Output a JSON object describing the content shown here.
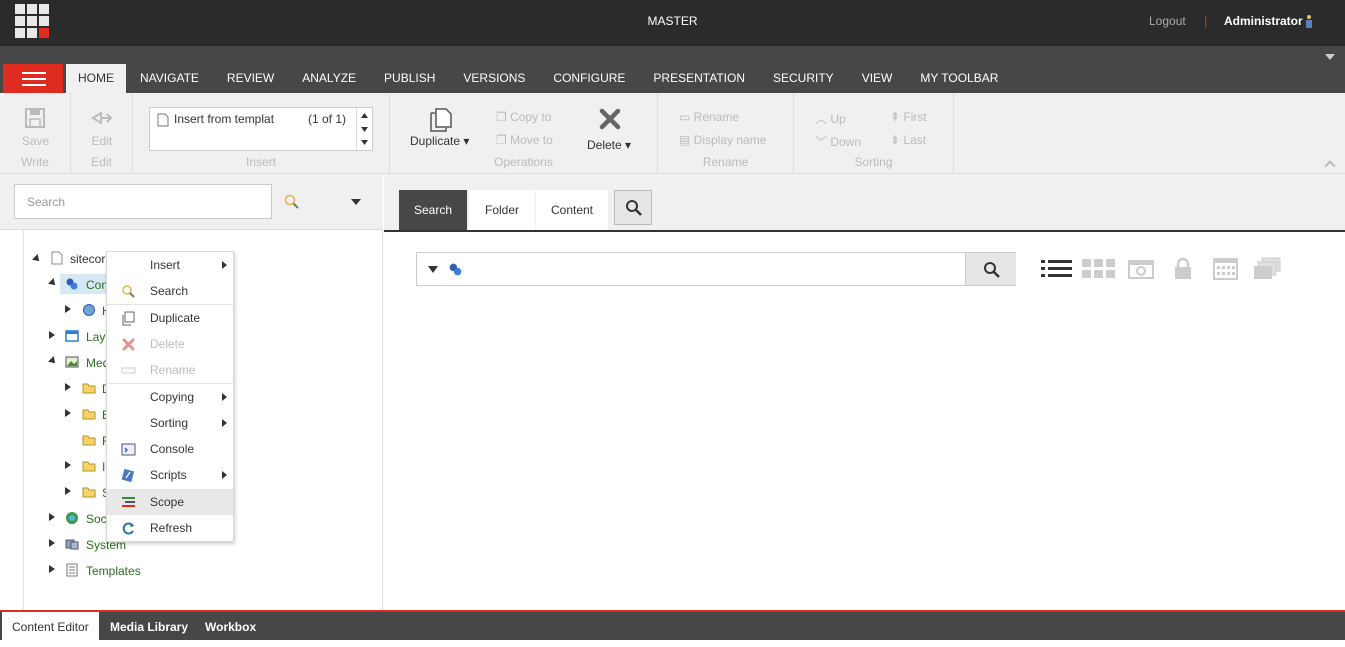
{
  "header": {
    "database": "MASTER",
    "logout": "Logout",
    "separator": "|",
    "user": "Administrator"
  },
  "nav": {
    "tabs": [
      "HOME",
      "NAVIGATE",
      "REVIEW",
      "ANALYZE",
      "PUBLISH",
      "VERSIONS",
      "CONFIGURE",
      "PRESENTATION",
      "SECURITY",
      "VIEW",
      "MY TOOLBAR"
    ],
    "active": "HOME"
  },
  "ribbon": {
    "write": {
      "save": "Save",
      "label": "Write"
    },
    "edit": {
      "edit": "Edit",
      "label": "Edit"
    },
    "insert": {
      "template": "Insert from templat",
      "count": "(1 of 1)",
      "label": "Insert"
    },
    "operations": {
      "duplicate": "Duplicate",
      "copy_to": "Copy to",
      "move_to": "Move to",
      "delete": "Delete",
      "label": "Operations"
    },
    "rename": {
      "rename": "Rename",
      "display_name": "Display name",
      "label": "Rename"
    },
    "sorting": {
      "up": "Up",
      "down": "Down",
      "first": "First",
      "last": "Last",
      "label": "Sorting"
    }
  },
  "tree": {
    "search_placeholder": "Search",
    "items": [
      {
        "label": "sitecor",
        "icon": "page-icon"
      },
      {
        "label": "Con",
        "icon": "content-icon"
      },
      {
        "label": "H",
        "icon": "home-icon"
      },
      {
        "label": "Lay",
        "icon": "layout-icon"
      },
      {
        "label": "Med",
        "icon": "media-icon"
      },
      {
        "label": "D",
        "icon": "folder-icon"
      },
      {
        "label": "E",
        "icon": "folder-icon"
      },
      {
        "label": "F",
        "icon": "folder-icon"
      },
      {
        "label": "I",
        "icon": "folder-icon"
      },
      {
        "label": "S",
        "icon": "folder-icon"
      },
      {
        "label": "Soc",
        "icon": "social-icon"
      },
      {
        "label": "System",
        "icon": "system-icon"
      },
      {
        "label": "Templates",
        "icon": "templates-icon"
      }
    ]
  },
  "context_menu": {
    "items": [
      "Insert",
      "Search",
      "Duplicate",
      "Delete",
      "Rename",
      "Copying",
      "Sorting",
      "Console",
      "Scripts",
      "Scope",
      "Refresh"
    ]
  },
  "right": {
    "tabs": [
      "Search",
      "Folder",
      "Content"
    ],
    "active_tab": "Search"
  },
  "bottom": {
    "tabs": [
      "Content Editor",
      "Media Library",
      "Workbox"
    ],
    "active": "Content Editor"
  },
  "colors": {
    "accent": "#e02b20",
    "dark": "#2b2b2b",
    "nav": "#474747"
  }
}
